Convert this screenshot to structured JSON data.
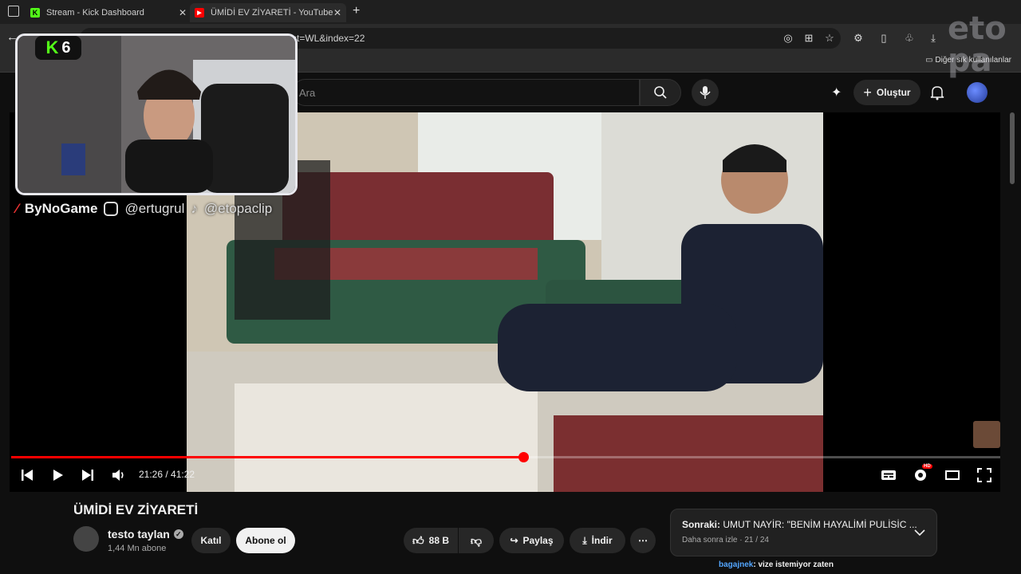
{
  "browser": {
    "tabs": [
      {
        "title": "Stream - Kick Dashboard",
        "icon": "kick-icon"
      },
      {
        "title": "ÜMİDİ EV ZİYARETİ - YouTube",
        "icon": "youtube-icon"
      }
    ],
    "url": "...M4bQM&list=WL&index=22",
    "bookmark_other": "Diğer sık kullanılanlar"
  },
  "youtube": {
    "search_placeholder": "Ara",
    "create_label": "Oluştur",
    "player": {
      "current_time": "21:26",
      "duration": "41:22",
      "time_display": "21:26 / 41:22",
      "progress": 0.518
    },
    "video": {
      "title": "ÜMİDİ EV ZİYARETİ",
      "channel": "testo taylan",
      "subscribers": "1,44 Mn abone",
      "join_label": "Katıl",
      "subscribe_label": "Abone ol",
      "likes": "88 B",
      "share_label": "Paylaş",
      "download_label": "İndir"
    },
    "up_next": {
      "prefix": "Sonraki:",
      "title": "UMUT NAYİR: \"BENİM HAYALİMİ PULİSİC ...",
      "subtitle": "Daha sonra izle · 21 / 24"
    }
  },
  "overlay": {
    "kick_viewers": "6",
    "brand": "ByNoGame",
    "instagram": "@ertugrul",
    "tiktok": "@etopaclip",
    "watermark": "eto pa"
  },
  "chat": {
    "user": "bagajnek",
    "message": ": vize istemiyor zaten"
  },
  "colors": {
    "accent": "#ff0000",
    "kick_green": "#53fc18",
    "background": "#0f0f0f"
  }
}
